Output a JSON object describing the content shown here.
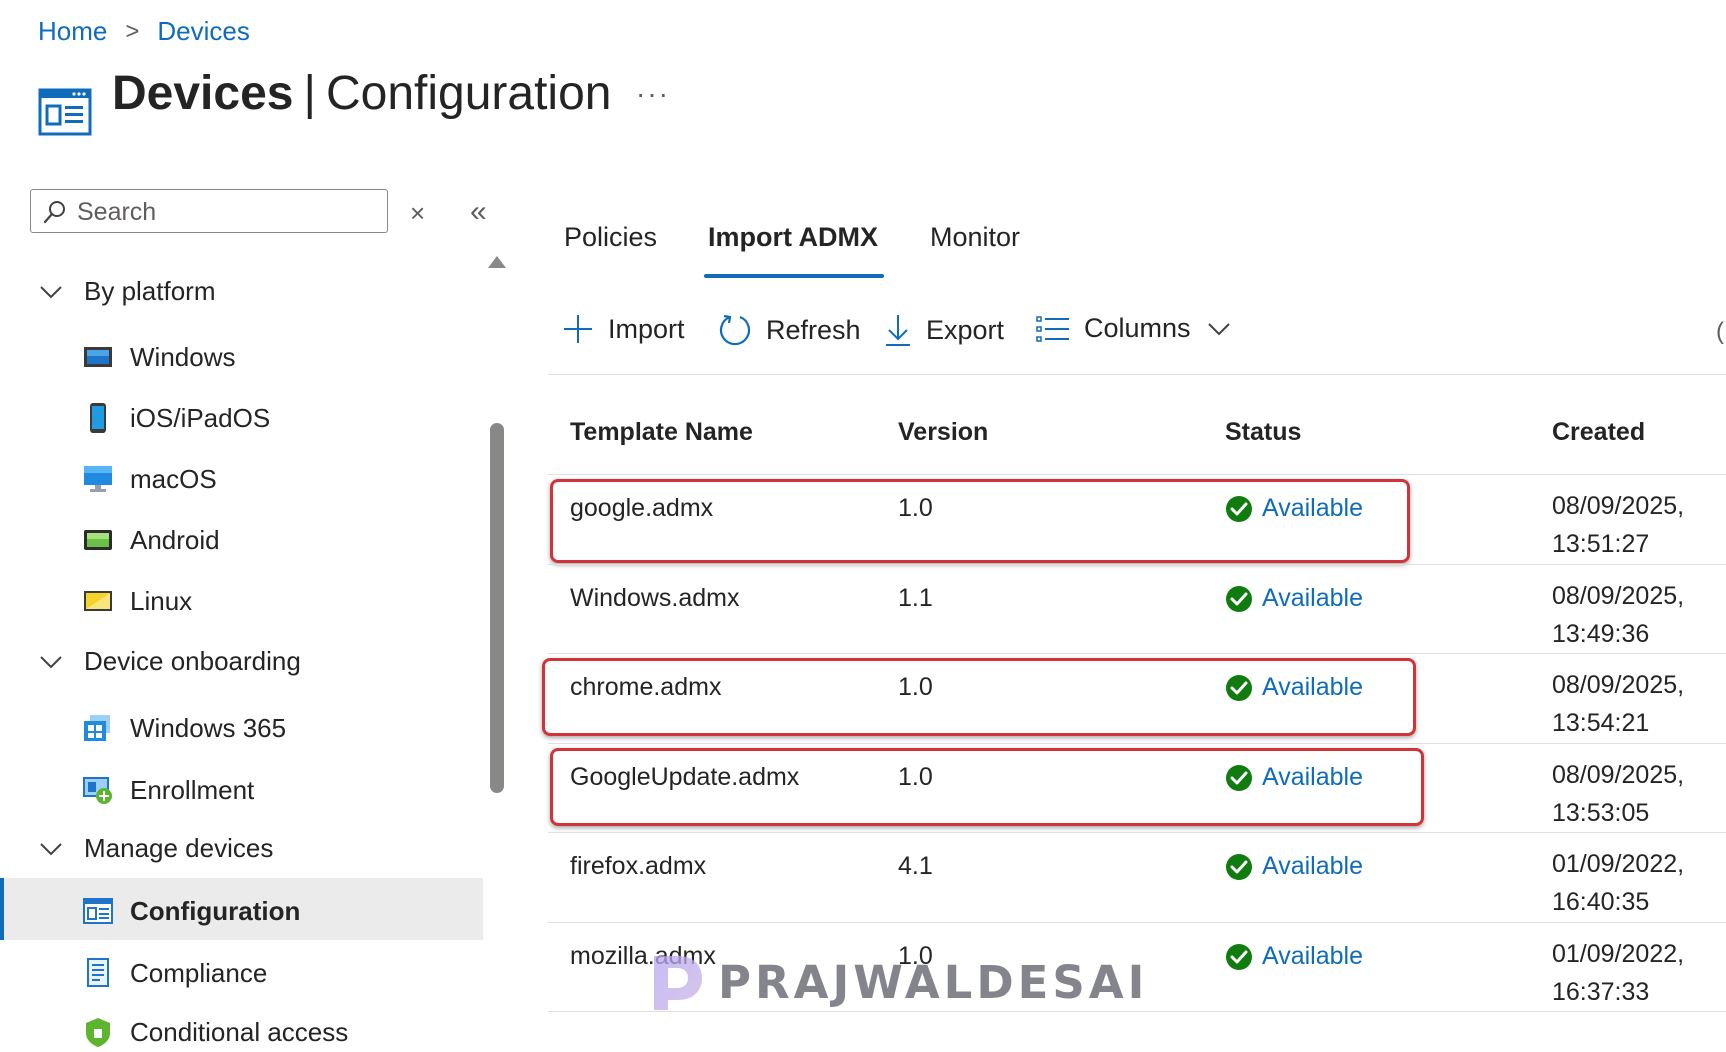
{
  "breadcrumb": {
    "home": "Home",
    "separator": ">",
    "current": "Devices"
  },
  "header": {
    "title_bold": "Devices",
    "title_separator": "|",
    "title_rest": "Configuration",
    "more": "···"
  },
  "sidebar": {
    "search_placeholder": "Search",
    "close_glyph": "×",
    "collapse_glyph": "«",
    "groups": [
      {
        "label": "By platform",
        "items": [
          {
            "label": "Windows",
            "icon": "windows-device-icon"
          },
          {
            "label": "iOS/iPadOS",
            "icon": "ios-device-icon"
          },
          {
            "label": "macOS",
            "icon": "macos-device-icon"
          },
          {
            "label": "Android",
            "icon": "android-device-icon"
          },
          {
            "label": "Linux",
            "icon": "linux-device-icon"
          }
        ]
      },
      {
        "label": "Device onboarding",
        "items": [
          {
            "label": "Windows 365",
            "icon": "windows-365-icon"
          },
          {
            "label": "Enrollment",
            "icon": "enrollment-icon"
          }
        ]
      },
      {
        "label": "Manage devices",
        "items": [
          {
            "label": "Configuration",
            "icon": "configuration-icon",
            "active": true
          },
          {
            "label": "Compliance",
            "icon": "compliance-icon"
          },
          {
            "label": "Conditional access",
            "icon": "conditional-access-icon"
          }
        ]
      }
    ]
  },
  "tabs": [
    {
      "label": "Policies",
      "active": false
    },
    {
      "label": "Import ADMX",
      "active": true
    },
    {
      "label": "Monitor",
      "active": false
    }
  ],
  "toolbar": {
    "import": "Import",
    "refresh": "Refresh",
    "export": "Export",
    "columns": "Columns"
  },
  "table": {
    "headers": [
      "Template Name",
      "Version",
      "Status",
      "Created"
    ],
    "rows": [
      {
        "name": "google.admx",
        "version": "1.0",
        "status": "Available",
        "created_date": "08/09/2025,",
        "created_time": "13:51:27",
        "highlighted": true
      },
      {
        "name": "Windows.admx",
        "version": "1.1",
        "status": "Available",
        "created_date": "08/09/2025,",
        "created_time": "13:49:36",
        "highlighted": false
      },
      {
        "name": "chrome.admx",
        "version": "1.0",
        "status": "Available",
        "created_date": "08/09/2025,",
        "created_time": "13:54:21",
        "highlighted": true
      },
      {
        "name": "GoogleUpdate.admx",
        "version": "1.0",
        "status": "Available",
        "created_date": "08/09/2025,",
        "created_time": "13:53:05",
        "highlighted": true
      },
      {
        "name": "firefox.admx",
        "version": "4.1",
        "status": "Available",
        "created_date": "01/09/2022,",
        "created_time": "16:40:35",
        "highlighted": false
      },
      {
        "name": "mozilla.admx",
        "version": "1.0",
        "status": "Available",
        "created_date": "01/09/2022,",
        "created_time": "16:37:33",
        "highlighted": false
      }
    ]
  },
  "watermark": {
    "text": "PRAJWALDESAI"
  },
  "colors": {
    "accent": "#0f6cbd",
    "success": "#107c10",
    "highlight": "#d13438"
  }
}
